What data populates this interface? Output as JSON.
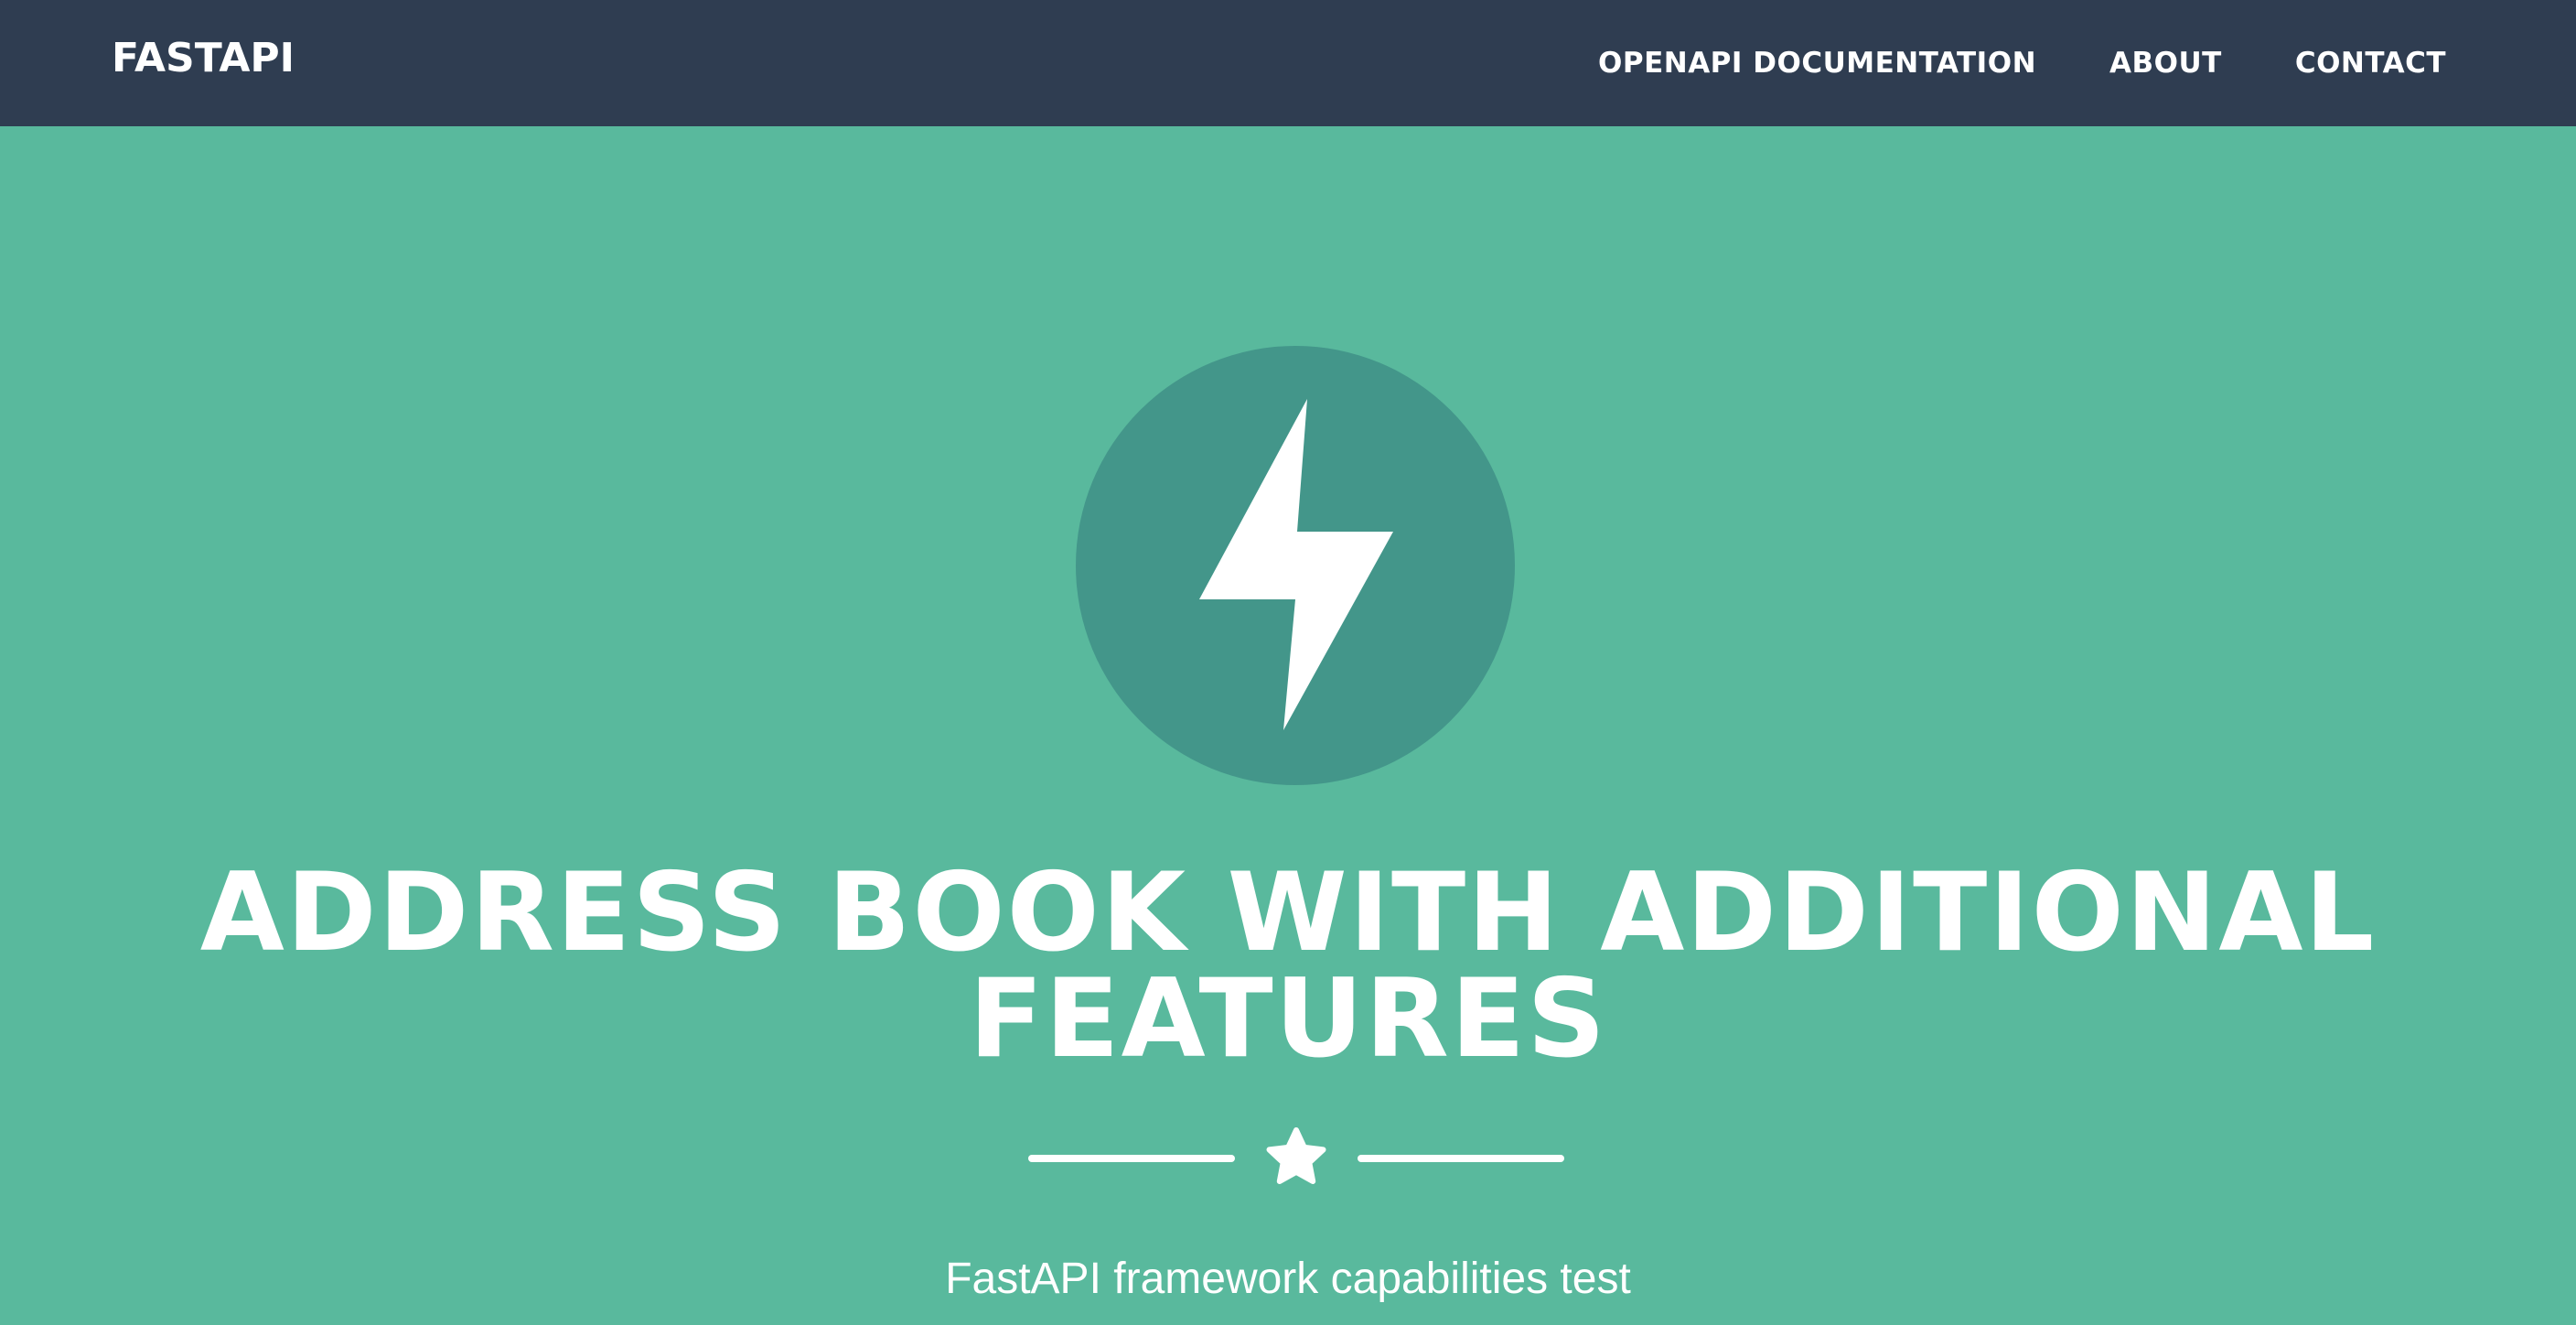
{
  "navbar": {
    "brand": "FASTAPI",
    "links": [
      {
        "label": "OPENAPI DOCUMENTATION"
      },
      {
        "label": "ABOUT"
      },
      {
        "label": "CONTACT"
      }
    ]
  },
  "hero": {
    "icon": "lightning-bolt-icon",
    "title": "ADDRESS BOOK WITH ADDITIONAL FEATURES",
    "divider_icon": "star-icon",
    "subtitle": "FastAPI framework capabilities test"
  },
  "colors": {
    "navbar_bg": "#2f3d51",
    "hero_bg": "#59b99d",
    "icon_circle": "#43968a",
    "text": "#ffffff"
  }
}
